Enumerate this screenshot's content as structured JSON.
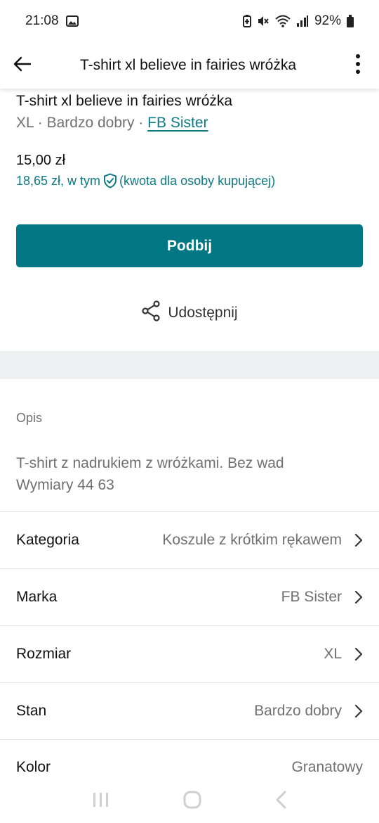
{
  "status_bar": {
    "time": "21:08",
    "battery": "92%"
  },
  "app_bar": {
    "title": "T-shirt xl believe in fairies wróżka"
  },
  "item": {
    "title": "T-shirt xl believe in fairies wróżka",
    "size": "XL",
    "separator": " · ",
    "condition": "Bardzo dobry",
    "brand": "FB Sister",
    "price": "15,00 zł",
    "buyer_price": "18,65 zł, w tym",
    "buyer_price_note": "(kwota dla osoby kupującej)"
  },
  "actions": {
    "bump_label": "Podbij",
    "share_label": "Udostępnij"
  },
  "description": {
    "label": "Opis",
    "line1": "T-shirt z nadrukiem z wróżkami. Bez wad",
    "line2": "Wymiary 44 63"
  },
  "attributes": [
    {
      "label": "Kategoria",
      "value": "Koszule z krótkim rękawem"
    },
    {
      "label": "Marka",
      "value": "FB Sister"
    },
    {
      "label": "Rozmiar",
      "value": "XL"
    },
    {
      "label": "Stan",
      "value": "Bardzo dobry"
    },
    {
      "label": "Kolor",
      "value": "Granatowy"
    }
  ],
  "colors": {
    "accent": "#007782",
    "link": "#0f7a84",
    "muted_text": "#707070",
    "band": "#edf1f2"
  },
  "icons": {
    "back": "arrow-left-icon",
    "menu": "more-vert-icon",
    "share": "share-icon",
    "shield": "shield-check-icon",
    "chevron": "chevron-right-icon"
  }
}
